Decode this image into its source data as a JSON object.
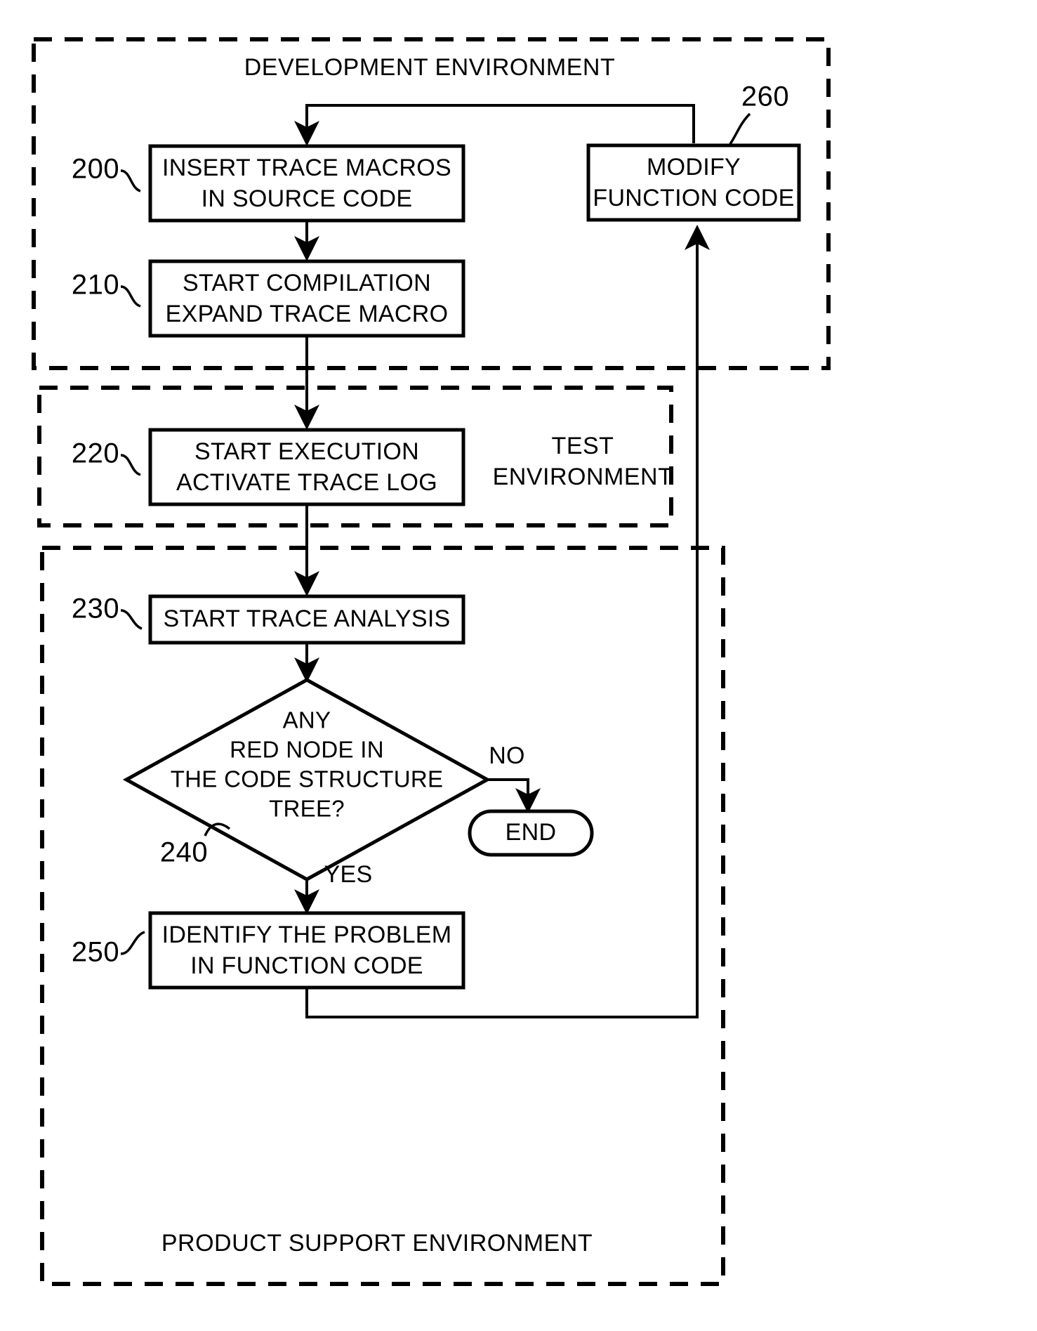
{
  "figure": {
    "type": "patent-flowchart",
    "background_color": "#ffffff",
    "line_color": "#000000"
  },
  "environments": [
    {
      "id": "development",
      "label": "DEVELOPMENT ENVIRONMENT",
      "label_position": "top"
    },
    {
      "id": "test",
      "label_line1": "TEST",
      "label_line2": "ENVIRONMENT",
      "label_position": "right"
    },
    {
      "id": "product-support",
      "label": "PRODUCT SUPPORT ENVIRONMENT",
      "label_position": "bottom"
    }
  ],
  "nodes": [
    {
      "id": "insert-trace-macros",
      "ref": "200",
      "shape": "rectangle",
      "line1": "INSERT TRACE MACROS",
      "line2": "IN SOURCE CODE"
    },
    {
      "id": "start-compilation",
      "ref": "210",
      "shape": "rectangle",
      "line1": "START COMPILATION",
      "line2": "EXPAND TRACE MACRO"
    },
    {
      "id": "start-execution",
      "ref": "220",
      "shape": "rectangle",
      "line1": "START EXECUTION",
      "line2": "ACTIVATE TRACE LOG"
    },
    {
      "id": "start-trace-analysis",
      "ref": "230",
      "shape": "rectangle",
      "line1": "START TRACE ANALYSIS",
      "line2": ""
    },
    {
      "id": "decision-red-node",
      "ref": "240",
      "shape": "diamond",
      "line1": "ANY",
      "line2": "RED NODE IN",
      "line3": "THE CODE STRUCTURE",
      "line4": "TREE?"
    },
    {
      "id": "identify-problem",
      "ref": "250",
      "shape": "rectangle",
      "line1": "IDENTIFY THE PROBLEM",
      "line2": "IN FUNCTION CODE"
    },
    {
      "id": "modify-function-code",
      "ref": "260",
      "shape": "rectangle",
      "line1": "MODIFY",
      "line2": "FUNCTION CODE"
    },
    {
      "id": "end-terminator",
      "ref": "",
      "shape": "rounded-terminator",
      "line1": "END",
      "line2": ""
    }
  ],
  "edge_labels": {
    "no": "NO",
    "yes": "YES"
  }
}
